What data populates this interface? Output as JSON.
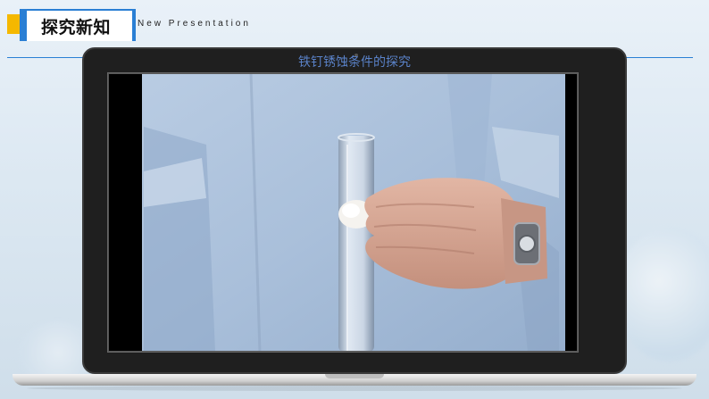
{
  "header": {
    "title": "探究新知",
    "subtitle": "New Presentation"
  },
  "slide": {
    "video_caption": "铁钉锈蚀条件的探究"
  },
  "colors": {
    "accent_blue": "#2a7fd4",
    "accent_yellow": "#f5b800",
    "caption_blue": "#5a82c8"
  }
}
